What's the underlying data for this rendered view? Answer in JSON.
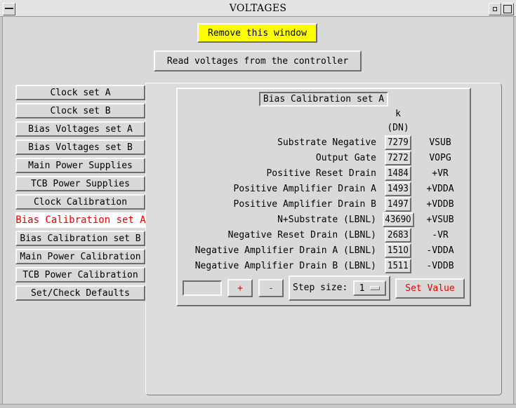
{
  "window": {
    "title": "VOLTAGES"
  },
  "top_buttons": {
    "remove": "Remove this window",
    "read": "Read voltages from the controller"
  },
  "tabs": [
    {
      "label": "Clock set A",
      "active": false
    },
    {
      "label": "Clock set B",
      "active": false
    },
    {
      "label": "Bias Voltages set A",
      "active": false
    },
    {
      "label": "Bias Voltages set B",
      "active": false
    },
    {
      "label": "Main Power Supplies",
      "active": false
    },
    {
      "label": "TCB Power Supplies",
      "active": false
    },
    {
      "label": "Clock Calibration",
      "active": false
    },
    {
      "label": "Bias Calibration set A",
      "active": true
    },
    {
      "label": "Bias Calibration set B",
      "active": false
    },
    {
      "label": "Main Power Calibration",
      "active": false
    },
    {
      "label": "TCB Power Calibration",
      "active": false
    },
    {
      "label": "Set/Check Defaults",
      "active": false
    }
  ],
  "panel": {
    "title": "Bias Calibration set A",
    "header_k": "k",
    "header_dn": "(DN)",
    "rows": [
      {
        "label": "Substrate Negative",
        "value": "7279",
        "code": "VSUB"
      },
      {
        "label": "Output Gate",
        "value": "7272",
        "code": "VOPG"
      },
      {
        "label": "Positive Reset Drain",
        "value": "1484",
        "code": "+VR"
      },
      {
        "label": "Positive Amplifier Drain A",
        "value": "1493",
        "code": "+VDDA"
      },
      {
        "label": "Positive Amplifier Drain B",
        "value": "1497",
        "code": "+VDDB"
      },
      {
        "label": "N+Substrate (LBNL)",
        "value": "43690",
        "code": "+VSUB"
      },
      {
        "label": "Negative Reset Drain (LBNL)",
        "value": "2683",
        "code": "-VR"
      },
      {
        "label": "Negative Amplifier Drain A (LBNL)",
        "value": "1510",
        "code": "-VDDA"
      },
      {
        "label": "Negative Amplifier Drain B (LBNL)",
        "value": "1511",
        "code": "-VDDB"
      }
    ]
  },
  "controls": {
    "entry_value": "",
    "plus": "+",
    "minus": "-",
    "step_label": "Step size:",
    "step_value": "1",
    "set_value": "Set Value"
  },
  "colors": {
    "accent_red": "#e00000",
    "highlight_yellow": "#ffff00"
  }
}
